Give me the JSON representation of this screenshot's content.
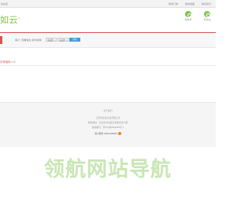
{
  "topbar": {
    "welcome": "欢迎您",
    "links": [
      "我的订单",
      "我的收藏",
      "联系我们"
    ]
  },
  "header": {
    "logo": "如云",
    "logo_mark": "®",
    "icons": [
      {
        "label": "微信号",
        "icon": "wechat-icon"
      },
      {
        "label": "手机站",
        "icon": "mobile-icon"
      }
    ]
  },
  "search": {
    "label": "客户 | 查看信息  条件选择：",
    "select1": "请选择",
    "select2": "请选择",
    "button": "搜索"
  },
  "breadcrumb": {
    "title": "字母选择",
    "sep": " > C"
  },
  "footer": {
    "line1": "关于我们",
    "line2": "江苏省某某企业有限公司",
    "line3": "联系地址：某某市某某区某某路某某大厦",
    "line4": "备案编号：苏ICP备0000000号-1",
    "line5": "客户服务 0000-000000"
  },
  "watermark": "领航网站导航"
}
